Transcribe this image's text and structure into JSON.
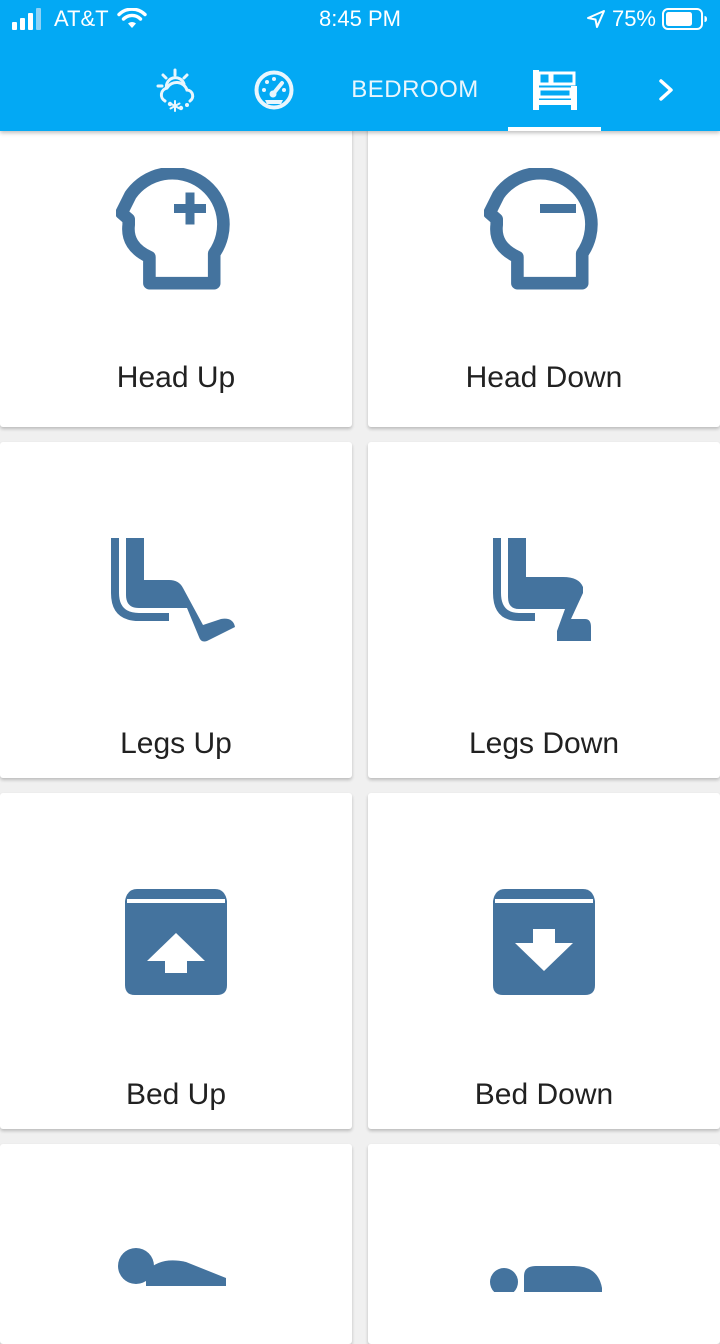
{
  "status_bar": {
    "carrier": "AT&T",
    "time": "8:45 PM",
    "battery": "75%"
  },
  "tabs": [
    {
      "name": "weather-tab",
      "icon": "weather-partly-snowy-icon"
    },
    {
      "name": "gauge-tab",
      "icon": "speedometer-icon"
    },
    {
      "name": "bedroom-tab",
      "label": "BEDROOM"
    },
    {
      "name": "bed-tab",
      "icon": "bed-icon",
      "active": true
    },
    {
      "name": "next-tab",
      "icon": "chevron-right-icon"
    }
  ],
  "colors": {
    "header": "#03a9f4",
    "icon": "#44739e",
    "card": "#ffffff",
    "background": "#f0f0f0"
  },
  "cards": [
    {
      "label": "Head Up",
      "icon": "head-plus-icon"
    },
    {
      "label": "Head Down",
      "icon": "head-minus-icon"
    },
    {
      "label": "Legs Up",
      "icon": "seat-legroom-extra-icon"
    },
    {
      "label": "Legs Down",
      "icon": "seat-legroom-normal-icon"
    },
    {
      "label": "Bed Up",
      "icon": "archive-arrow-up-icon"
    },
    {
      "label": "Bed Down",
      "icon": "archive-arrow-down-icon"
    },
    {
      "label": "",
      "icon": "flat-person-icon"
    },
    {
      "label": "",
      "icon": "bed-outline-icon"
    }
  ]
}
